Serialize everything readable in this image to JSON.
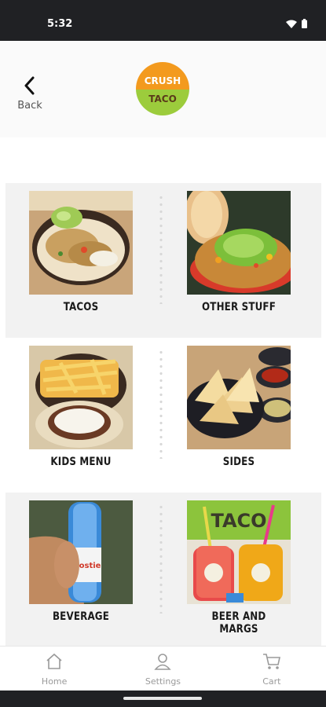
{
  "status_bar": {
    "time": "5:32"
  },
  "header": {
    "back_label": "Back",
    "logo_line1": "CRUSH",
    "logo_line2": "TACO"
  },
  "menu": {
    "items": [
      {
        "label": "TACOS"
      },
      {
        "label": "OTHER STUFF"
      },
      {
        "label": "KIDS MENU"
      },
      {
        "label": "SIDES"
      },
      {
        "label": "BEVERAGE"
      },
      {
        "label": "BEER AND MARGS"
      }
    ]
  },
  "beverage_bottle_text": "Frostie",
  "beer_sign_text": "TACO",
  "bottom_nav": {
    "home": "Home",
    "settings": "Settings",
    "cart": "Cart"
  },
  "colors": {
    "logo_orange": "#f39a1e",
    "logo_green": "#9ccc3c",
    "status_bar": "#202124",
    "band": "#f2f2f2"
  }
}
